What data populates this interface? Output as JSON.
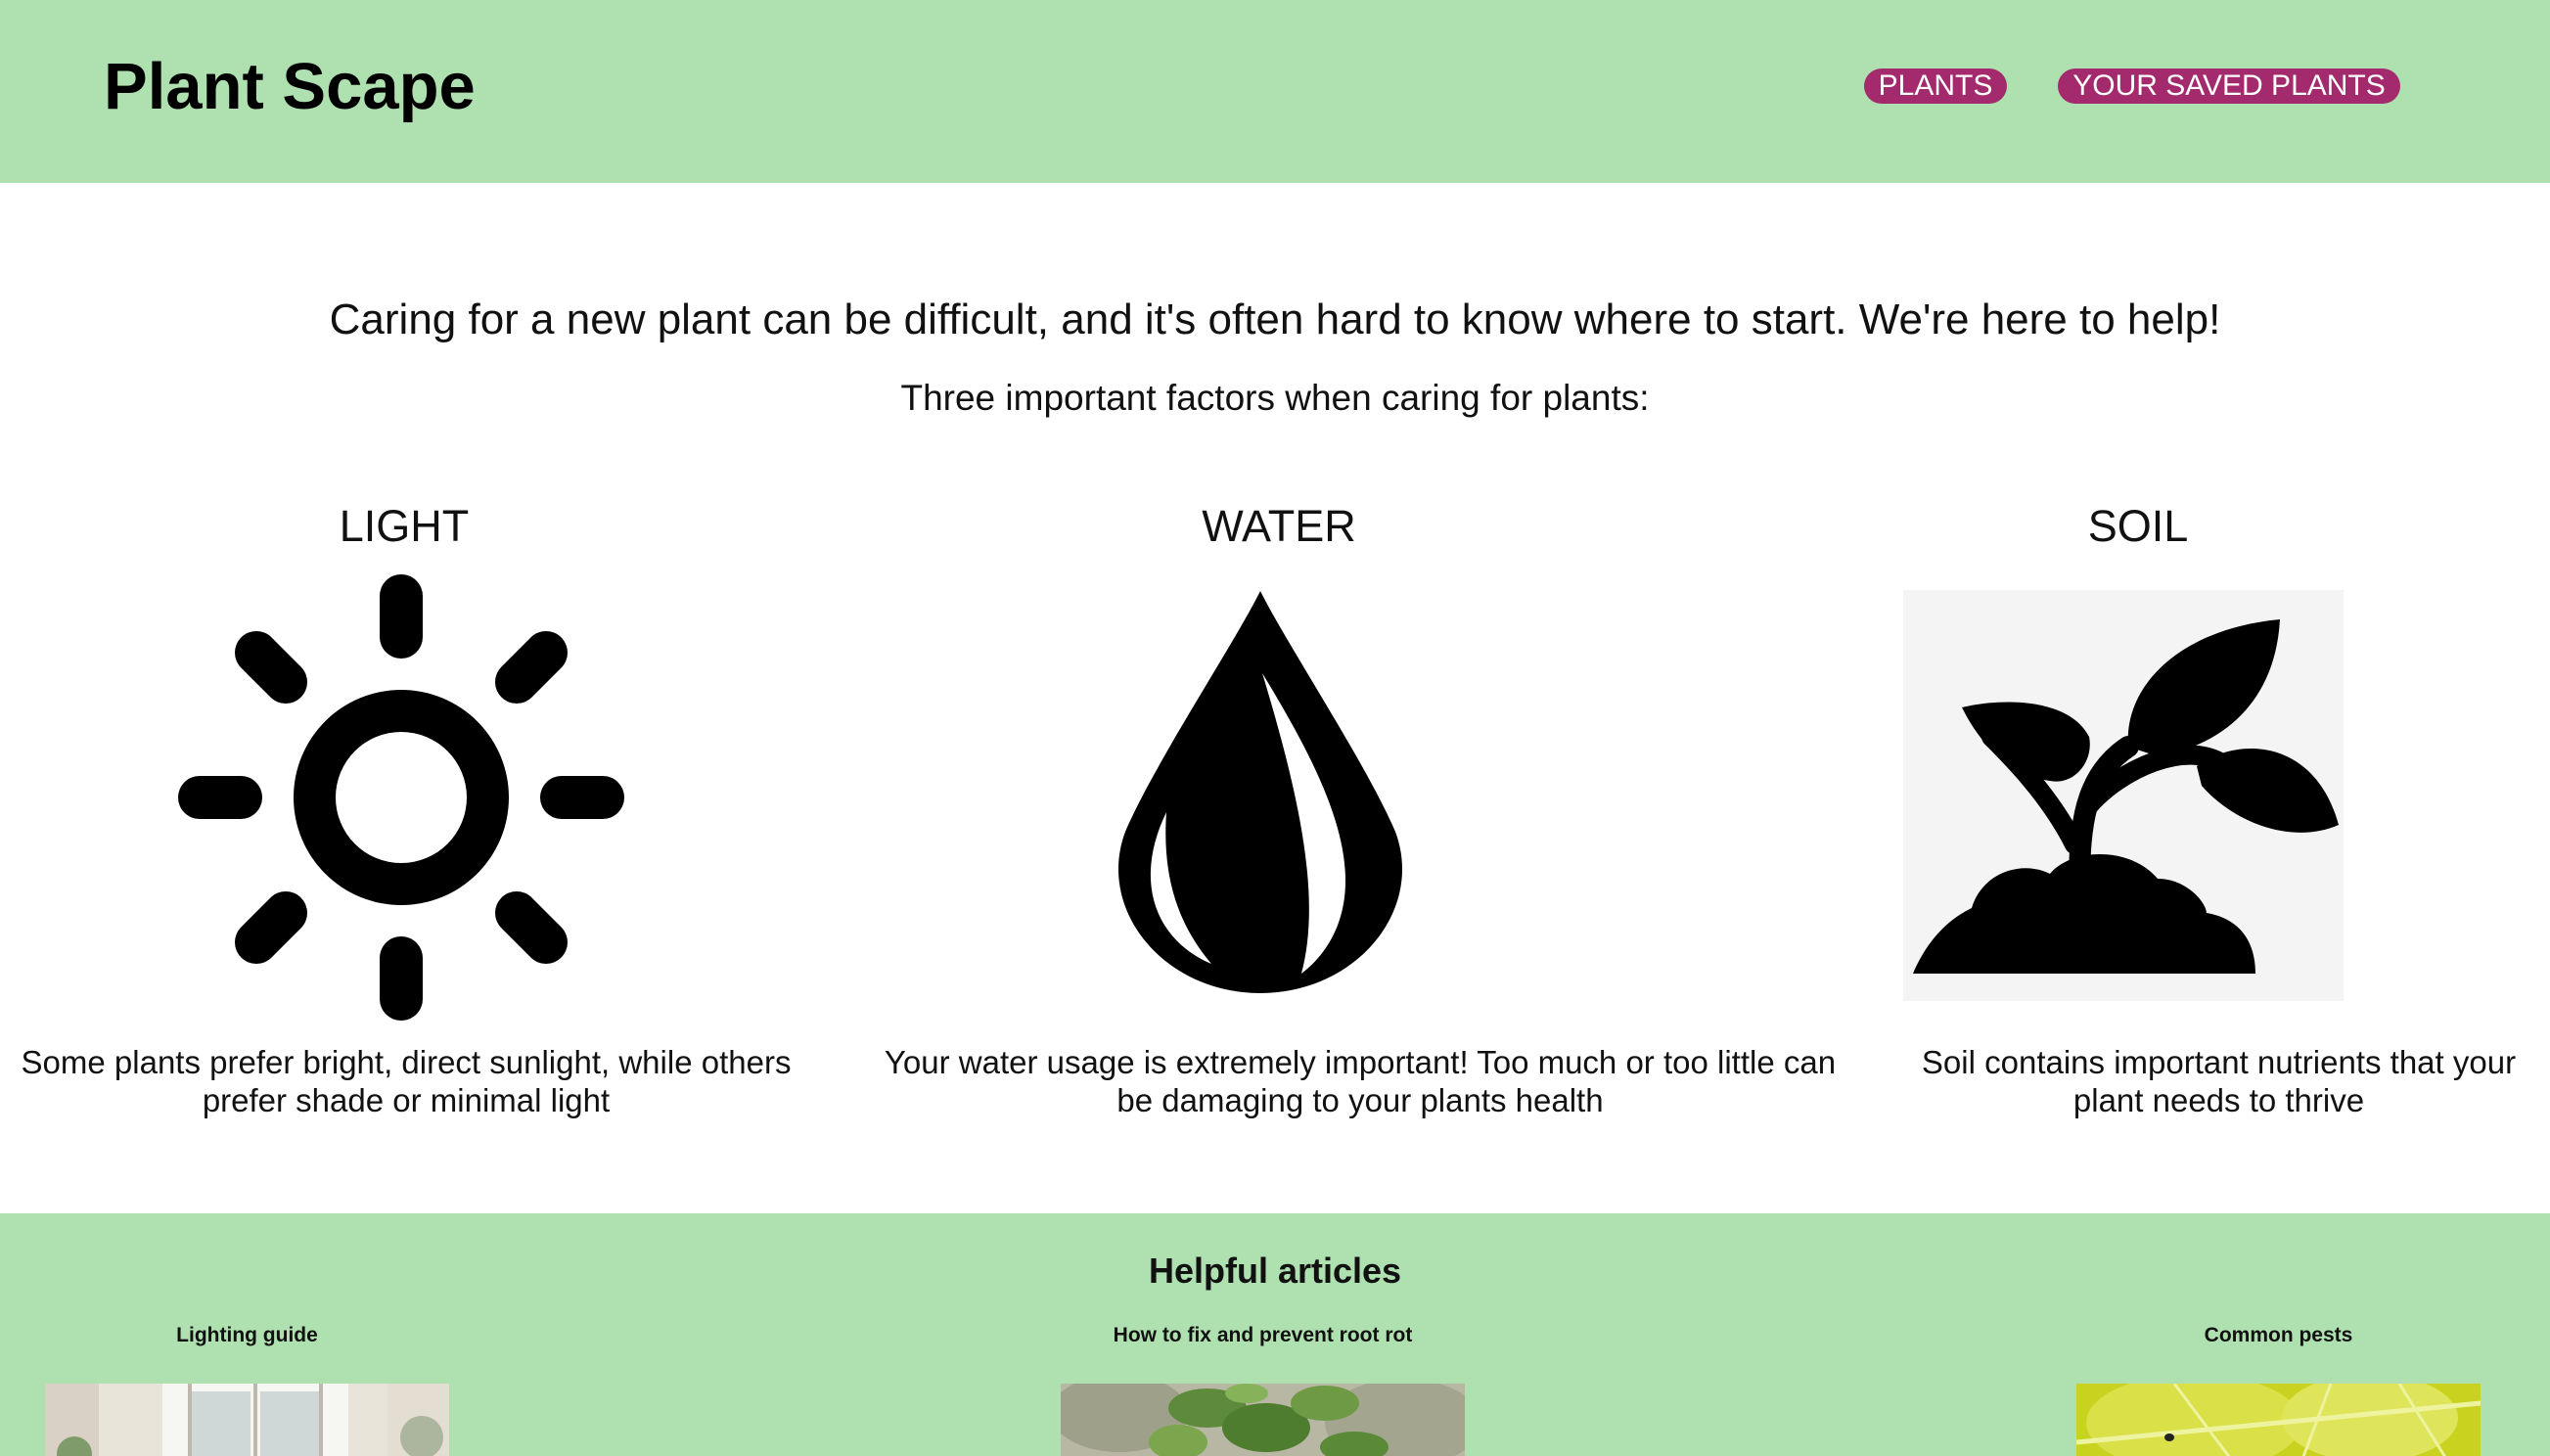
{
  "header": {
    "brand": "Plant Scape",
    "nav": {
      "plants": "PLANTS",
      "saved": "YOUR SAVED PLANTS"
    }
  },
  "intro": {
    "main": "Caring for a new plant can be difficult, and it's often hard to know where to start. We're here to help!",
    "sub": "Three important factors when caring for plants:"
  },
  "factors": [
    {
      "title": "LIGHT",
      "icon": "sun-icon",
      "desc": "Some plants prefer bright, direct sunlight, while others prefer shade or minimal light"
    },
    {
      "title": "WATER",
      "icon": "water-drop-icon",
      "desc": "Your water usage is extremely important! Too much or too little can be damaging to your plants health"
    },
    {
      "title": "SOIL",
      "icon": "sprout-icon",
      "desc": "Soil contains important nutrients that your plant needs to thrive"
    }
  ],
  "articles": {
    "heading": "Helpful articles",
    "items": [
      {
        "title": "Lighting guide"
      },
      {
        "title": "How to fix and prevent root rot"
      },
      {
        "title": "Common pests"
      }
    ]
  },
  "colors": {
    "header_bg": "#afe1b0",
    "pill_bg": "#a32a6c",
    "pill_text": "#ffffff"
  }
}
